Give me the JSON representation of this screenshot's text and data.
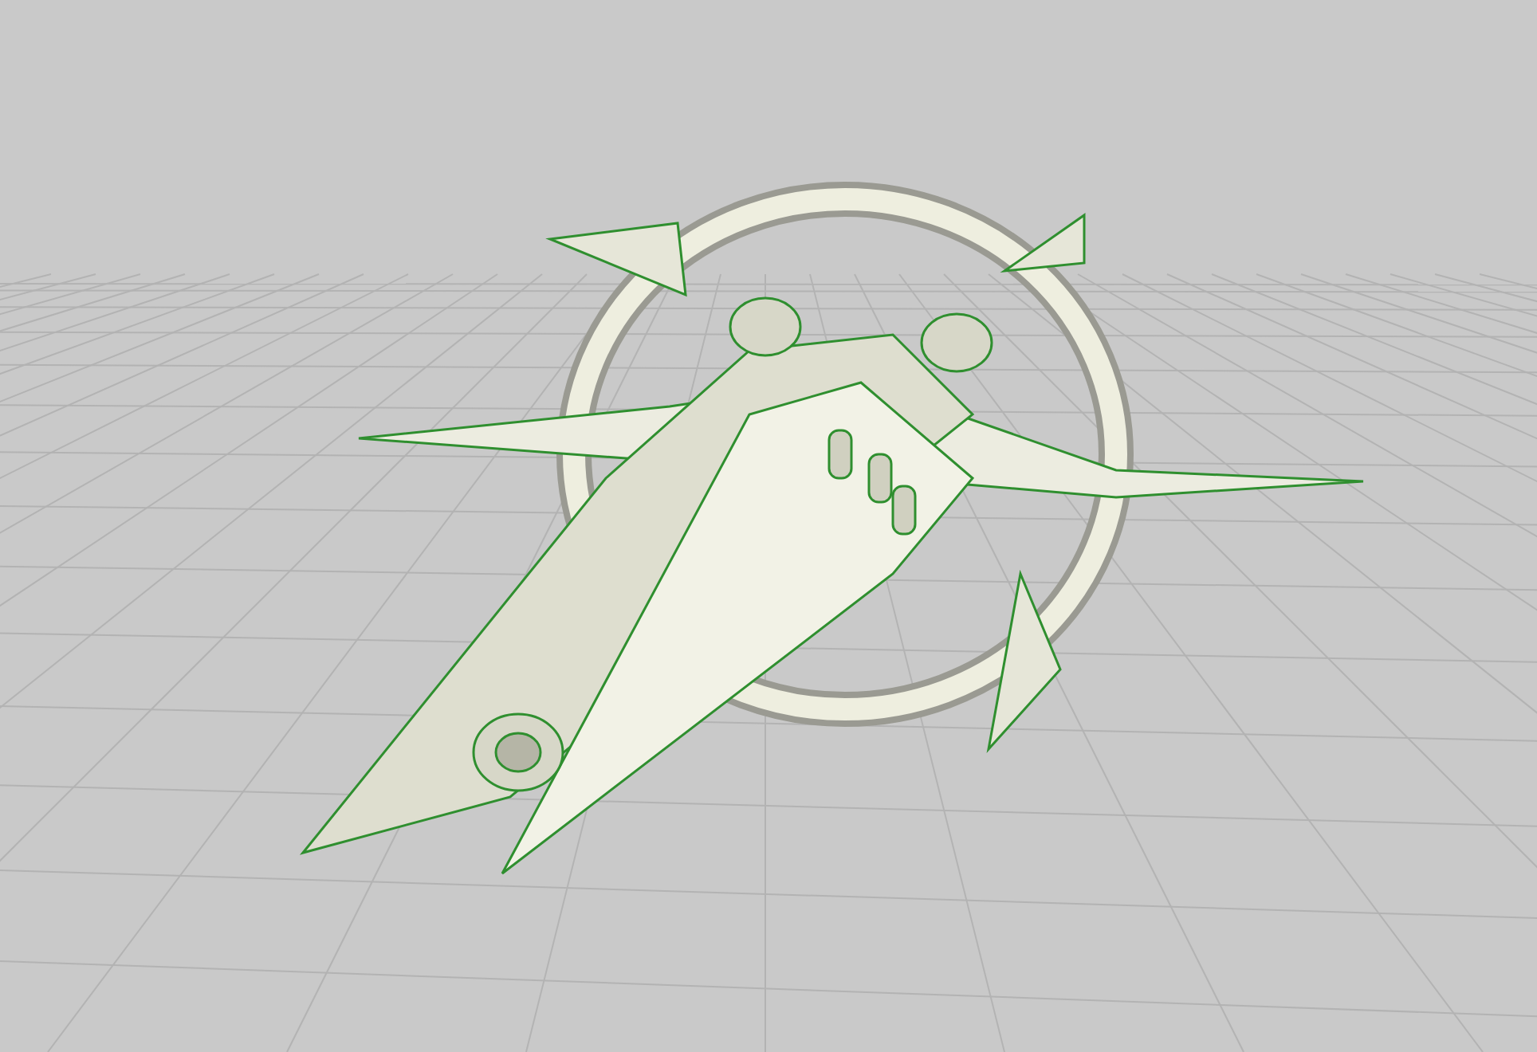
{
  "viewport": {
    "grid_visible": true,
    "wireframe_visible": true
  }
}
